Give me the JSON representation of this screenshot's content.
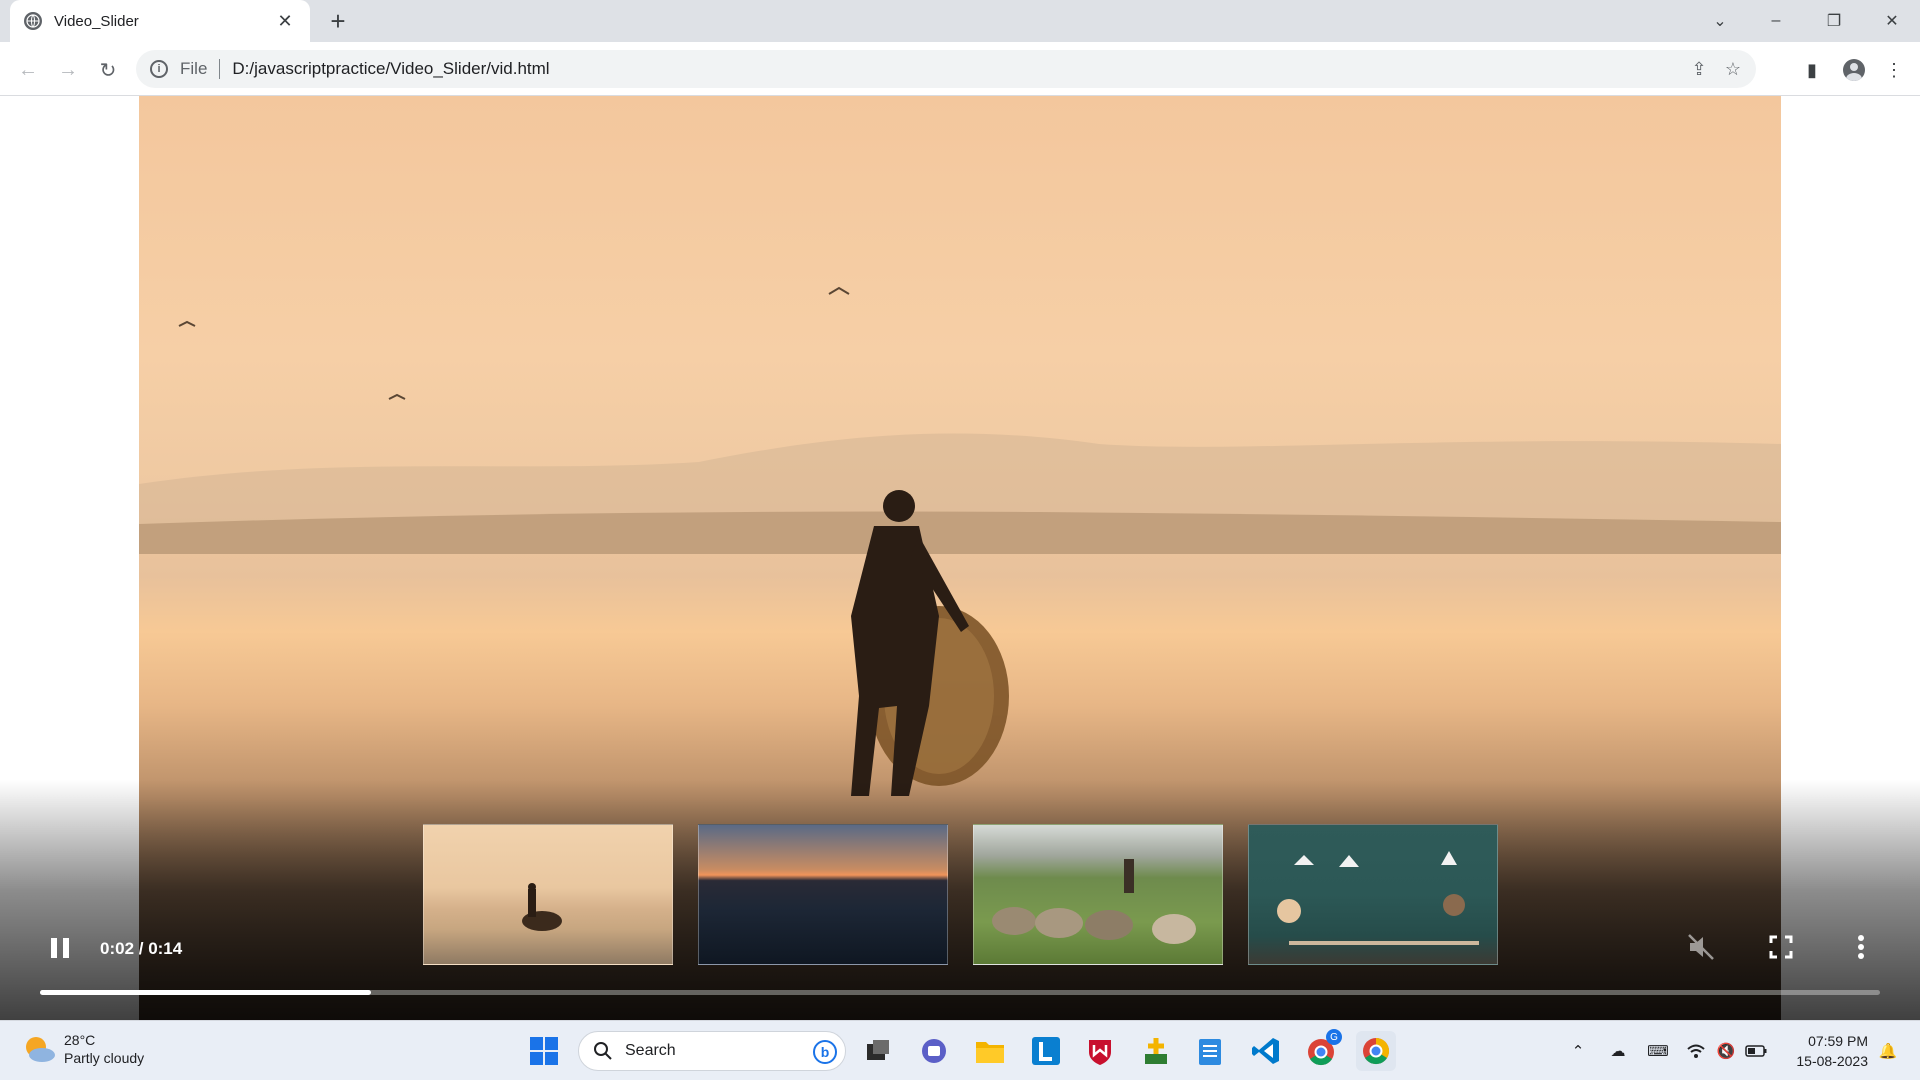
{
  "browser": {
    "tab_title": "Video_Slider",
    "omnibox_scheme": "File",
    "url": "D:/javascriptpractice/Video_Slider/vid.html"
  },
  "player": {
    "time_display": "0:02 / 0:14",
    "progress_fraction": 0.18,
    "thumbnails": [
      "beach-fisherman",
      "sunset-sea",
      "shepherd-sheep",
      "office-cafe"
    ]
  },
  "taskbar": {
    "weather_temp": "28°C",
    "weather_desc": "Partly cloudy",
    "search_label": "Search",
    "time": "07:59 PM",
    "date": "15-08-2023",
    "chrome_badge": "G"
  }
}
